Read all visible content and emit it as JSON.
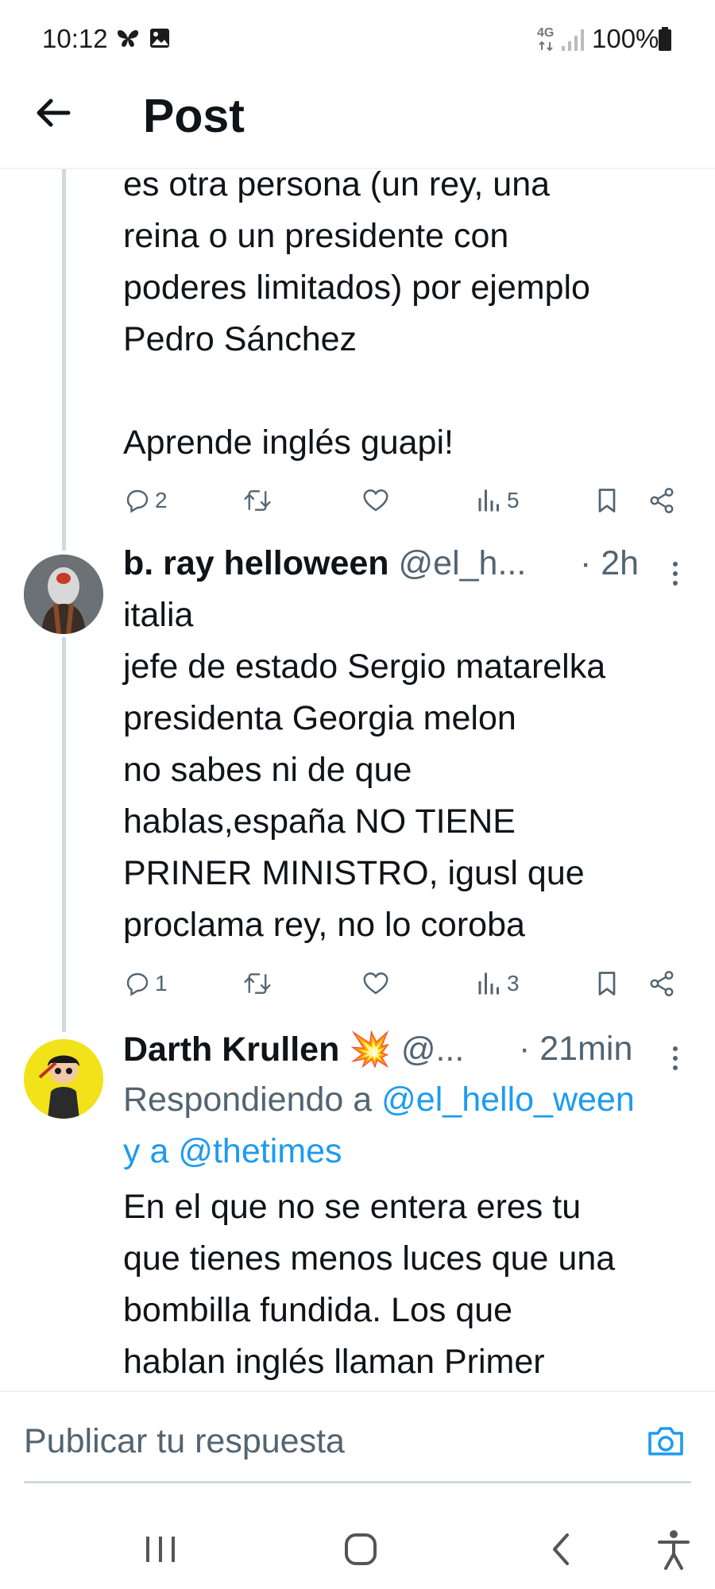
{
  "status_bar": {
    "time": "10:12",
    "battery": "100%",
    "network": "4G"
  },
  "header": {
    "title": "Post"
  },
  "tweets": [
    {
      "body_lines": [
        "es otra persona (un rey, una",
        "reina o un presidente con",
        "poderes limitados) por ejemplo",
        "Pedro Sánchez",
        "",
        "Aprende inglés guapi!"
      ],
      "replies": "2",
      "views": "5"
    },
    {
      "name": "b. ray helloween",
      "handle": "@el_h...",
      "time": "· 2h",
      "body_lines": [
        "italia",
        "jefe de estado  Sergio matarelka",
        "presidenta Georgia melon",
        "no sabes ni de que",
        "hablas,españa NO TIENE",
        "PRINER MINISTRO, igusl que",
        "proclama rey, no lo coroba"
      ],
      "replies": "1",
      "views": "3"
    },
    {
      "name": "Darth Krullen",
      "name_emoji": "💥",
      "handle": "@...",
      "time": "· 21min",
      "reply_prefix": "Respondiendo a",
      "reply_handle_1": "@el_hello_ween",
      "reply_join": "y a",
      "reply_handle_2": "@thetimes",
      "body_lines": [
        "En el que no se entera eres tu",
        "que tienes menos luces que una",
        "bombilla fundida. Los que",
        "hablan inglés llaman Primer"
      ]
    }
  ],
  "compose": {
    "placeholder": "Publicar tu respuesta"
  },
  "colors": {
    "accent": "#1d9bf0",
    "text": "#0f1419",
    "secondary": "#536471",
    "thread_line": "#cfd9de"
  },
  "icons": [
    "arrow-left-icon",
    "reply-icon",
    "retweet-icon",
    "like-icon",
    "views-icon",
    "bookmark-icon",
    "share-icon",
    "more-icon",
    "camera-icon",
    "recents-icon",
    "home-icon",
    "back-nav-icon",
    "accessibility-icon"
  ]
}
